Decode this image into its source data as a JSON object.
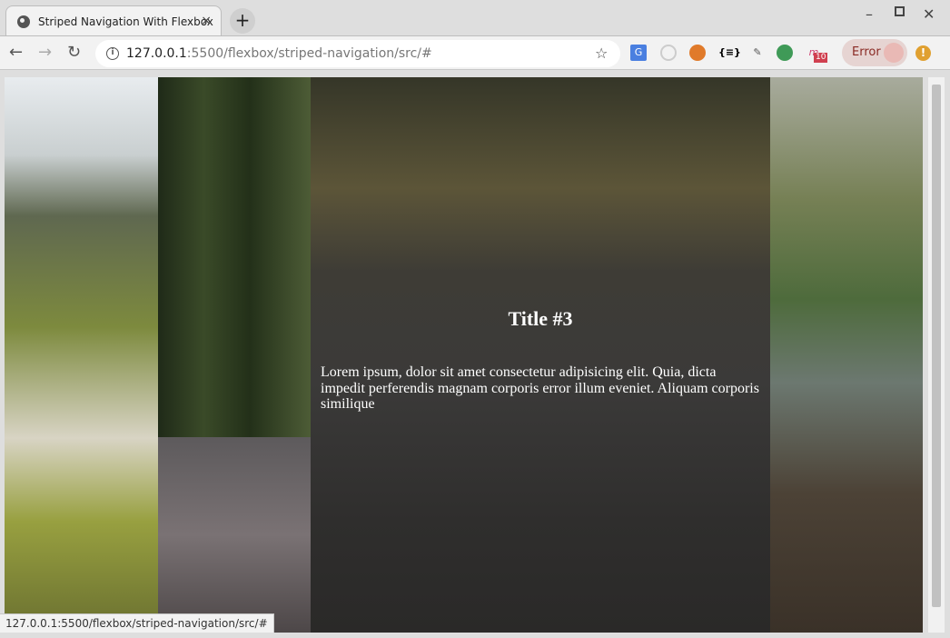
{
  "browser": {
    "tab_title": "Striped Navigation With Flexbox",
    "tab_close": "×",
    "new_tab": "+",
    "url_host": "127.0.0.1",
    "url_path": ":5500/flexbox/striped-navigation/src/#",
    "error_label": "Error",
    "extension_badge": "10",
    "status_url": "127.0.0.1:5500/flexbox/striped-navigation/src/#"
  },
  "page": {
    "active_stripe": {
      "title": "Title #3",
      "text": "Lorem ipsum, dolor sit amet consectetur adipisicing elit. Quia, dicta impedit perferendis magnam corporis error illum eveniet. Aliquam corporis similique"
    }
  }
}
